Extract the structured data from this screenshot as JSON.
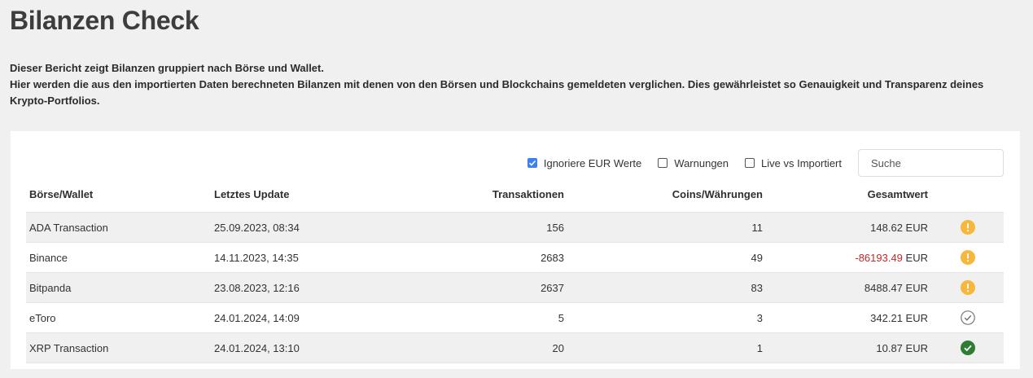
{
  "page": {
    "title": "Bilanzen Check",
    "intro_line1": "Dieser Bericht zeigt Bilanzen gruppiert nach Börse und Wallet.",
    "intro_line2": "Hier werden die aus den importierten Daten berechneten Bilanzen mit denen von den Börsen und Blockchains gemeldeten verglichen. Dies gewährleistet so Genauigkeit und Transparenz deines Krypto-Portfolios."
  },
  "filters": {
    "ignore_eur": {
      "label": "Ignoriere EUR Werte",
      "checked": true
    },
    "warnings": {
      "label": "Warnungen",
      "checked": false
    },
    "live_vs_imported": {
      "label": "Live vs Importiert",
      "checked": false
    },
    "search_placeholder": "Suche"
  },
  "table": {
    "headers": {
      "wallet": "Börse/Wallet",
      "last_update": "Letztes Update",
      "transactions": "Transaktionen",
      "coins": "Coins/Währungen",
      "total": "Gesamtwert"
    },
    "rows": [
      {
        "wallet": "ADA Transaction",
        "last_update": "25.09.2023, 08:34",
        "transactions": "156",
        "coins": "11",
        "total_value": "148.62",
        "currency": "EUR",
        "status": "warning"
      },
      {
        "wallet": "Binance",
        "last_update": "14.11.2023, 14:35",
        "transactions": "2683",
        "coins": "49",
        "total_value": "-86193.49",
        "currency": "EUR",
        "status": "warning"
      },
      {
        "wallet": "Bitpanda",
        "last_update": "23.08.2023, 12:16",
        "transactions": "2637",
        "coins": "83",
        "total_value": "8488.47",
        "currency": "EUR",
        "status": "warning"
      },
      {
        "wallet": "eToro",
        "last_update": "24.01.2024, 14:09",
        "transactions": "5",
        "coins": "3",
        "total_value": "342.21",
        "currency": "EUR",
        "status": "neutral-check"
      },
      {
        "wallet": "XRP Transaction",
        "last_update": "24.01.2024, 13:10",
        "transactions": "20",
        "coins": "1",
        "total_value": "10.87",
        "currency": "EUR",
        "status": "ok-check"
      }
    ]
  },
  "colors": {
    "warning": "#f5b83d",
    "ok": "#2e7d32",
    "negative": "#c62828",
    "checkbox_checked": "#3d82e8"
  }
}
